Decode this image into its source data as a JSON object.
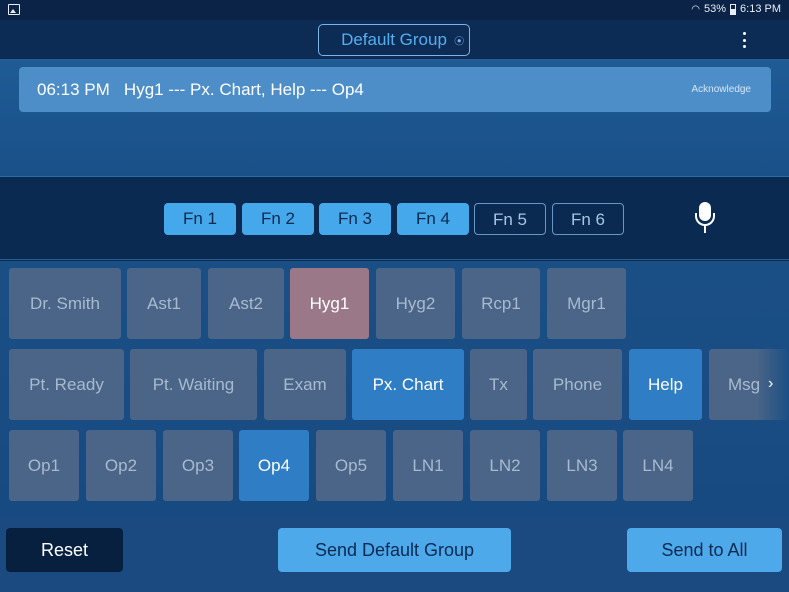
{
  "status_bar": {
    "battery": "53%",
    "time": "6:13 PM"
  },
  "header": {
    "group_name": "Default Group"
  },
  "message": {
    "text": "06:13 PM   Hyg1 --- Px. Chart, Help --- Op4",
    "acknowledge_label": "Acknowledge"
  },
  "function_keys": [
    {
      "label": "Fn 1",
      "active": true
    },
    {
      "label": "Fn 2",
      "active": true
    },
    {
      "label": "Fn 3",
      "active": true
    },
    {
      "label": "Fn 4",
      "active": true
    },
    {
      "label": "Fn 5",
      "active": false
    },
    {
      "label": "Fn 6",
      "active": false
    }
  ],
  "people": [
    {
      "label": "Dr. Smith",
      "selected": false
    },
    {
      "label": "Ast1",
      "selected": false
    },
    {
      "label": "Ast2",
      "selected": false
    },
    {
      "label": "Hyg1",
      "selected": true
    },
    {
      "label": "Hyg2",
      "selected": false
    },
    {
      "label": "Rcp1",
      "selected": false
    },
    {
      "label": "Mgr1",
      "selected": false
    }
  ],
  "messages": [
    {
      "label": "Pt. Ready",
      "selected": false
    },
    {
      "label": "Pt. Waiting",
      "selected": false
    },
    {
      "label": "Exam",
      "selected": false
    },
    {
      "label": "Px. Chart",
      "selected": true
    },
    {
      "label": "Tx",
      "selected": false
    },
    {
      "label": "Phone",
      "selected": false
    },
    {
      "label": "Help",
      "selected": true
    },
    {
      "label": "Msg",
      "selected": false
    }
  ],
  "rooms": [
    {
      "label": "Op1",
      "selected": false
    },
    {
      "label": "Op2",
      "selected": false
    },
    {
      "label": "Op3",
      "selected": false
    },
    {
      "label": "Op4",
      "selected": true
    },
    {
      "label": "Op5",
      "selected": false
    },
    {
      "label": "LN1",
      "selected": false
    },
    {
      "label": "LN2",
      "selected": false
    },
    {
      "label": "LN3",
      "selected": false
    },
    {
      "label": "LN4",
      "selected": false
    }
  ],
  "bottom": {
    "reset_label": "Reset",
    "send_group_label": "Send  Default Group",
    "send_all_label": "Send to All"
  },
  "colors": {
    "background": "#0b2a52",
    "accent": "#4ea9ea",
    "selected_person": "#9a7888",
    "selected_item": "#2f7dc4",
    "tile": "#4a6587"
  }
}
